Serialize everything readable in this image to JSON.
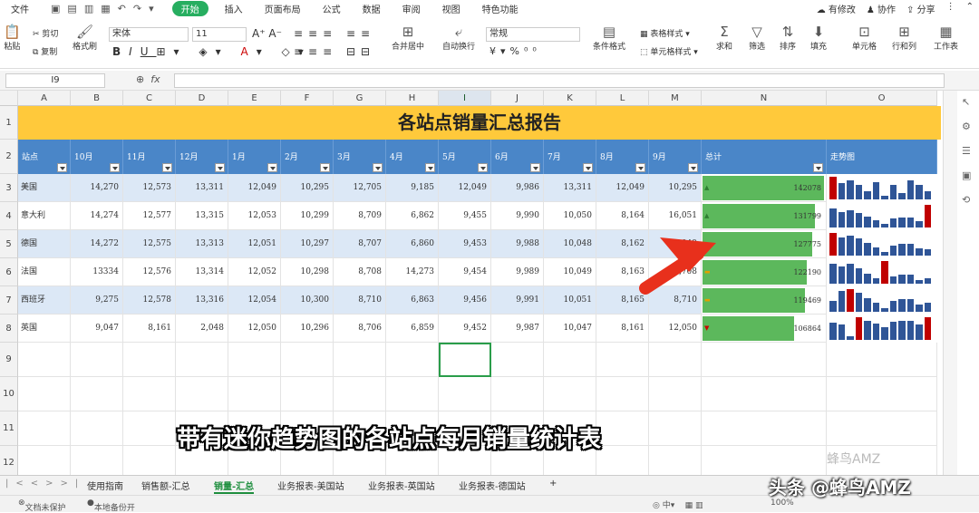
{
  "menu": {
    "file": "文件",
    "tabs": [
      "开始",
      "插入",
      "页面布局",
      "公式",
      "数据",
      "审阅",
      "视图",
      "特色功能"
    ],
    "active": "开始",
    "right": [
      "有修改",
      "协作",
      "分享"
    ]
  },
  "ribbon": {
    "paste": "粘贴",
    "cut": "剪切",
    "copy": "复制",
    "format_painter": "格式刷",
    "font": "宋体",
    "size": "11",
    "merge": "合并居中",
    "wrap": "自动换行",
    "number_format": "常规",
    "conditional": "条件格式",
    "table_style": "表格样式",
    "cell_style": "单元格样式",
    "sum": "求和",
    "filter": "筛选",
    "sort": "排序",
    "fill": "填充",
    "cell": "单元格",
    "row_col": "行和列",
    "worksheet": "工作表"
  },
  "formula_bar": {
    "name_box": "I9",
    "fx": "fx"
  },
  "columns": [
    "A",
    "B",
    "C",
    "D",
    "E",
    "F",
    "G",
    "H",
    "I",
    "J",
    "K",
    "L",
    "M",
    "N",
    "O"
  ],
  "selected_column": "I",
  "rows": [
    "1",
    "2",
    "3",
    "4",
    "5",
    "6",
    "7",
    "8",
    "9",
    "10",
    "11",
    "12"
  ],
  "report": {
    "title": "各站点销量汇总报告",
    "headers": [
      "站点",
      "10月",
      "11月",
      "12月",
      "1月",
      "2月",
      "3月",
      "4月",
      "5月",
      "6月",
      "7月",
      "8月",
      "9月",
      "总计",
      "走势图"
    ],
    "data": [
      {
        "site": "美国",
        "m": [
          "14,270",
          "12,573",
          "13,311",
          "12,049",
          "10,295",
          "12,705",
          "9,185",
          "12,049",
          "9,986",
          "13,311",
          "12,049",
          "10,295"
        ],
        "total": "142078",
        "trend": "up",
        "spark": [
          14270,
          12573,
          13311,
          12049,
          10295,
          12705,
          9185,
          12049,
          9986,
          13311,
          12049,
          10295
        ]
      },
      {
        "site": "意大利",
        "m": [
          "14,274",
          "12,577",
          "13,315",
          "12,053",
          "10,299",
          "8,709",
          "6,862",
          "9,455",
          "9,990",
          "10,050",
          "8,164",
          "16,051"
        ],
        "total": "131799",
        "trend": "up",
        "spark": [
          14274,
          12577,
          13315,
          12053,
          10299,
          8709,
          6862,
          9455,
          9990,
          10050,
          8164,
          16051
        ]
      },
      {
        "site": "德国",
        "m": [
          "14,272",
          "12,575",
          "13,313",
          "12,051",
          "10,297",
          "8,707",
          "6,860",
          "9,453",
          "9,988",
          "10,048",
          "8,162",
          "8,049"
        ],
        "total": "127775",
        "trend": "flat",
        "spark": [
          14272,
          12575,
          13313,
          12051,
          10297,
          8707,
          6860,
          9453,
          9988,
          10048,
          8162,
          8049
        ]
      },
      {
        "site": "法国",
        "m": [
          "13334",
          "12,576",
          "13,314",
          "12,052",
          "10,298",
          "8,708",
          "14,273",
          "9,454",
          "9,989",
          "10,049",
          "8,163",
          "8,708"
        ],
        "total": "122190",
        "trend": "flat",
        "spark": [
          13334,
          12576,
          13314,
          12052,
          10298,
          8708,
          14273,
          9454,
          9989,
          10049,
          8163,
          8708
        ]
      },
      {
        "site": "西班牙",
        "m": [
          "9,275",
          "12,578",
          "13,316",
          "12,054",
          "10,300",
          "8,710",
          "6,863",
          "9,456",
          "9,991",
          "10,051",
          "8,165",
          "8,710"
        ],
        "total": "119469",
        "trend": "flat",
        "spark": [
          9275,
          12578,
          13316,
          12054,
          10300,
          8710,
          6863,
          9456,
          9991,
          10051,
          8165,
          8710
        ]
      },
      {
        "site": "英国",
        "m": [
          "9,047",
          "8,161",
          "2,048",
          "12,050",
          "10,296",
          "8,706",
          "6,859",
          "9,452",
          "9,987",
          "10,047",
          "8,161",
          "12,050"
        ],
        "total": "106864",
        "trend": "down",
        "spark": [
          9047,
          8161,
          2048,
          12050,
          10296,
          8706,
          6859,
          9452,
          9987,
          10047,
          8161,
          12050
        ]
      }
    ]
  },
  "colors": {
    "title_bg": "#ffc93b",
    "header_bg": "#4a86c8",
    "band": "#dce8f6",
    "total_bar": "#5cb85c",
    "spark_bar": "#2f5597",
    "spark_max": "#c00000",
    "select": "#2a9d4a"
  },
  "sheet_tabs": [
    "使用指南",
    "销售额-汇总",
    "销量-汇总",
    "业务报表-美国站",
    "业务报表-英国站",
    "业务报表-德国站"
  ],
  "active_sheet": "销量-汇总",
  "status": {
    "protect": "文档未保护",
    "backup": "本地备份开",
    "zoom": "100%"
  },
  "subtitle": "带有迷你趋势图的各站点每月销量统计表",
  "watermark": "头条 @蜂鸟AMZ",
  "watermark_faint": "蜂鸟AMZ"
}
